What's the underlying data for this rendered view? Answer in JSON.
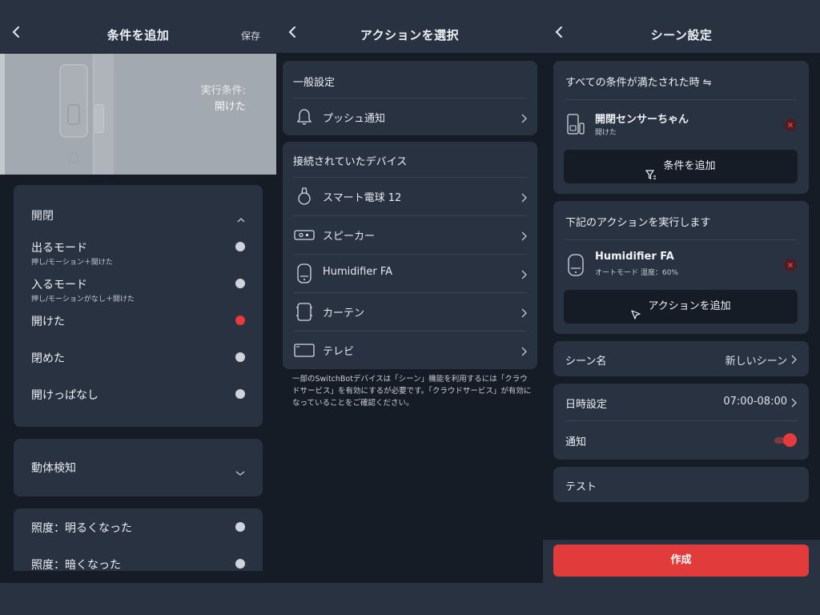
{
  "colors": {
    "background": "#161c25",
    "card": "#283241",
    "accent_red": "#e23b3b"
  },
  "panel1": {
    "title": "条件を追加",
    "save": "保存",
    "hero": {
      "caption": "実行条件:",
      "value": "開けた"
    },
    "section_open_close": {
      "title": "開閉",
      "items": [
        {
          "label": "出るモード",
          "sub": "押し/モーション＋開けた",
          "selected": false
        },
        {
          "label": "入るモード",
          "sub": "押し/モーションがなし＋開けた",
          "selected": false
        },
        {
          "label": "開けた",
          "sub": "",
          "selected": true
        },
        {
          "label": "閉めた",
          "sub": "",
          "selected": false
        },
        {
          "label": "開けっぱなし",
          "sub": "",
          "selected": false
        }
      ]
    },
    "section_motion": {
      "title": "動体検知"
    },
    "section_light": {
      "items": [
        {
          "label": "照度：明るくなった",
          "selected": false
        },
        {
          "label": "照度：暗くなった",
          "selected": false
        }
      ]
    }
  },
  "panel2": {
    "title": "アクションを選択",
    "general": {
      "title": "一般設定",
      "items": [
        {
          "label": "プッシュ通知",
          "icon": "bell-icon"
        }
      ]
    },
    "devices": {
      "title": "接続されていたデバイス",
      "items": [
        {
          "label": "スマート電球 12",
          "icon": "bulb-icon"
        },
        {
          "label": "スピーカー",
          "icon": "speaker-icon"
        },
        {
          "label": "Humidifier FA",
          "icon": "humidifier-icon"
        },
        {
          "label": "カーテン",
          "icon": "curtain-icon"
        },
        {
          "label": "テレビ",
          "icon": "tv-icon"
        }
      ]
    },
    "note": "一部のSwitchBotデバイスは「シーン」機能を利用するには「クラウドサービス」を有効にするが必要です。「クラウドサービス」が有効になっていることをご確認ください。"
  },
  "panel3": {
    "title": "シーン設定",
    "conditions": {
      "title": "すべての条件が満たされた時 ⇋",
      "device_name": "開閉センサーちゃん",
      "device_state": "開けた",
      "add_button": "条件を追加"
    },
    "actions": {
      "title": "下記のアクションを実行します",
      "device_name": "Humidifier FA",
      "device_state": "オートモード 湿度：60%",
      "add_button": "アクションを追加"
    },
    "scene_name": {
      "label": "シーン名",
      "value": "新しいシーン"
    },
    "schedule": {
      "label": "日時設定",
      "value": "07:00-08:00"
    },
    "notify": {
      "label": "通知",
      "enabled": true
    },
    "test": {
      "label": "テスト"
    },
    "create_button": "作成"
  }
}
